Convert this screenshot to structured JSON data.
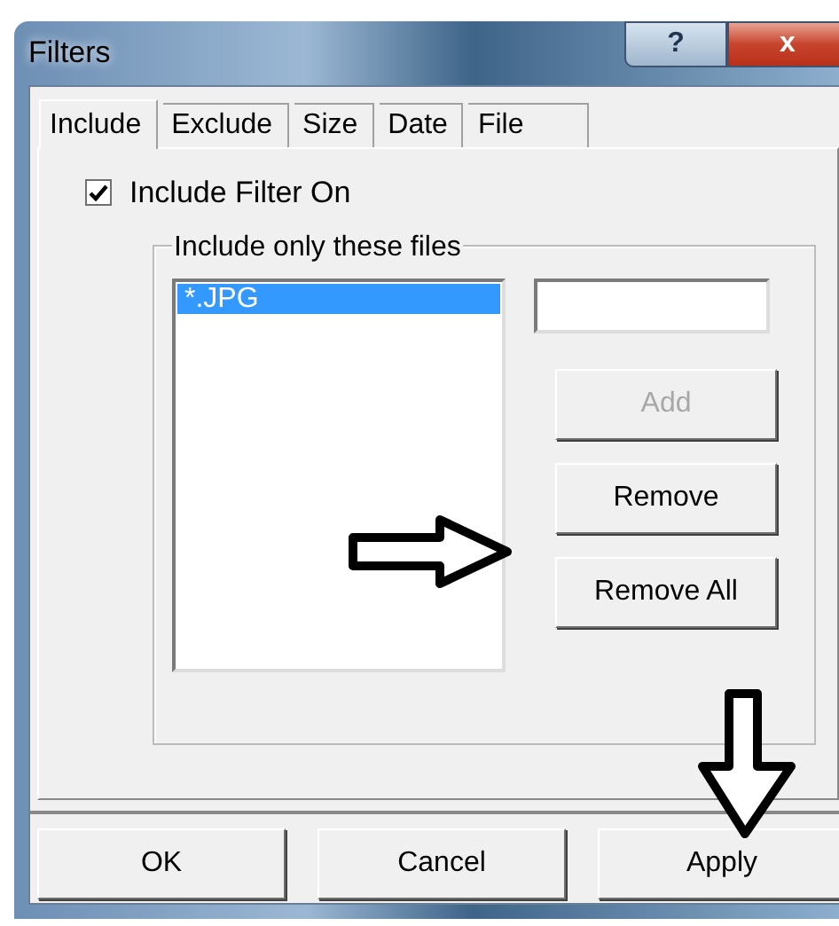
{
  "window": {
    "title": "Filters",
    "help_button": "?",
    "close_button": "x"
  },
  "tabs": [
    {
      "label": "Include",
      "selected": true
    },
    {
      "label": "Exclude",
      "selected": false
    },
    {
      "label": "Size",
      "selected": false
    },
    {
      "label": "Date",
      "selected": false
    },
    {
      "label": "File",
      "selected": false
    }
  ],
  "include_filter": {
    "label": "Include Filter On",
    "checked": true
  },
  "group": {
    "title": "Include only these files",
    "files": [
      {
        "name": "*.JPG",
        "selected": true
      }
    ],
    "buttons": [
      {
        "label": "Add",
        "disabled": true
      },
      {
        "label": "Remove",
        "disabled": false
      },
      {
        "label": "Remove All",
        "disabled": false
      }
    ]
  },
  "dialog_buttons": [
    {
      "label": "OK"
    },
    {
      "label": "Cancel"
    },
    {
      "label": "Apply"
    }
  ],
  "annotations": [
    {
      "kind": "right"
    },
    {
      "kind": "down"
    }
  ]
}
